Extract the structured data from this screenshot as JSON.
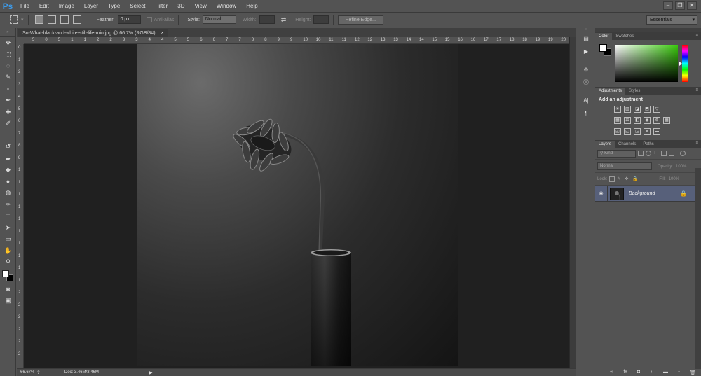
{
  "app": {
    "logo": "Ps"
  },
  "menu": [
    "File",
    "Edit",
    "Image",
    "Layer",
    "Type",
    "Select",
    "Filter",
    "3D",
    "View",
    "Window",
    "Help"
  ],
  "window_controls": {
    "minimize": "–",
    "restore": "❐",
    "close": "✕"
  },
  "options": {
    "feather_label": "Feather:",
    "feather_value": "0 px",
    "antialias_label": "Anti-alias",
    "style_label": "Style:",
    "style_value": "Normal",
    "width_label": "Width:",
    "height_label": "Height:",
    "refine_edge": "Refine Edge...",
    "swap_icon": "⇄"
  },
  "workspace": "Essentials",
  "document": {
    "tab_title": "So-What-black-and-white-still-life-min.jpg @ 66.7% (RGB/8#)",
    "tab_close": "×",
    "zoom": "66.67%",
    "doc_size": "Doc: 3.46M/3.46M",
    "status_arrow": "▶",
    "ruler_top": [
      "5",
      "0",
      "5",
      "1",
      "1",
      "2",
      "2",
      "3",
      "3",
      "4",
      "4",
      "5",
      "5",
      "6",
      "6",
      "7",
      "7",
      "8",
      "8",
      "9",
      "9",
      "10",
      "10",
      "11",
      "11",
      "12",
      "12",
      "13",
      "13",
      "14",
      "14",
      "15",
      "15",
      "16",
      "16",
      "17",
      "17",
      "18",
      "18",
      "19",
      "19",
      "20"
    ],
    "ruler_left": [
      "0",
      "1",
      "2",
      "3",
      "4",
      "5",
      "6",
      "7",
      "8",
      "9",
      "1",
      "1",
      "1",
      "1",
      "1",
      "1",
      "1",
      "1",
      "1",
      "1",
      "2",
      "2",
      "2",
      "2",
      "2",
      "2"
    ]
  },
  "tools": [
    {
      "name": "move-tool",
      "glyph": "✥"
    },
    {
      "name": "marquee-tool",
      "glyph": "⬚"
    },
    {
      "name": "lasso-tool",
      "glyph": "◌"
    },
    {
      "name": "quick-selection-tool",
      "glyph": "✎"
    },
    {
      "name": "crop-tool",
      "glyph": "⌗"
    },
    {
      "name": "eyedropper-tool",
      "glyph": "✒"
    },
    {
      "name": "healing-brush-tool",
      "glyph": "✚"
    },
    {
      "name": "brush-tool",
      "glyph": "✐"
    },
    {
      "name": "clone-stamp-tool",
      "glyph": "⊥"
    },
    {
      "name": "history-brush-tool",
      "glyph": "↺"
    },
    {
      "name": "eraser-tool",
      "glyph": "▰"
    },
    {
      "name": "paint-bucket-tool",
      "glyph": "◆"
    },
    {
      "name": "blur-tool",
      "glyph": "●"
    },
    {
      "name": "dodge-tool",
      "glyph": "◍"
    },
    {
      "name": "pen-tool",
      "glyph": "✑"
    },
    {
      "name": "type-tool",
      "glyph": "T"
    },
    {
      "name": "path-selection-tool",
      "glyph": "➤"
    },
    {
      "name": "rectangle-tool",
      "glyph": "▭"
    },
    {
      "name": "hand-tool",
      "glyph": "✋"
    },
    {
      "name": "zoom-tool",
      "glyph": "⚲"
    }
  ],
  "tools_bottom": [
    {
      "name": "quick-mask-icon",
      "glyph": "◙"
    },
    {
      "name": "screen-mode-icon",
      "glyph": "▣"
    }
  ],
  "dock": [
    {
      "name": "history-panel-icon",
      "glyph": "▤"
    },
    {
      "name": "actions-panel-icon",
      "glyph": "▶"
    },
    {
      "name": "properties-panel-icon",
      "glyph": "⚙"
    },
    {
      "name": "info-panel-icon",
      "glyph": "ⓘ"
    },
    {
      "name": "character-panel-icon",
      "glyph": "A|"
    },
    {
      "name": "paragraph-panel-icon",
      "glyph": "¶"
    }
  ],
  "color_panel": {
    "tabs": [
      "Color",
      "Swatches"
    ],
    "menu": "≡"
  },
  "adjustments_panel": {
    "tabs": [
      "Adjustments",
      "Styles"
    ],
    "menu": "≡",
    "title": "Add an adjustment",
    "rows": [
      [
        {
          "name": "brightness-contrast-icon",
          "glyph": "☀"
        },
        {
          "name": "levels-icon",
          "glyph": "▥"
        },
        {
          "name": "curves-icon",
          "glyph": "◪"
        },
        {
          "name": "exposure-icon",
          "glyph": "◩"
        },
        {
          "name": "vibrance-icon",
          "glyph": "▽"
        }
      ],
      [
        {
          "name": "hue-saturation-icon",
          "glyph": "▦"
        },
        {
          "name": "color-balance-icon",
          "glyph": "⚖"
        },
        {
          "name": "black-white-icon",
          "glyph": "◧"
        },
        {
          "name": "photo-filter-icon",
          "glyph": "◉"
        },
        {
          "name": "channel-mixer-icon",
          "glyph": "⊛"
        },
        {
          "name": "color-lookup-icon",
          "glyph": "▦"
        }
      ],
      [
        {
          "name": "invert-icon",
          "glyph": "◰"
        },
        {
          "name": "posterize-icon",
          "glyph": "◱"
        },
        {
          "name": "threshold-icon",
          "glyph": "◲"
        },
        {
          "name": "selective-color-icon",
          "glyph": "✕"
        },
        {
          "name": "gradient-map-icon",
          "glyph": "▬"
        }
      ]
    ]
  },
  "layers_panel": {
    "tabs": [
      "Layers",
      "Channels",
      "Paths"
    ],
    "menu": "≡",
    "filter_label": "Kind",
    "blend_mode": "Normal",
    "opacity_label": "Opacity:",
    "opacity_value": "100%",
    "lock_label": "Lock:",
    "fill_label": "Fill:",
    "fill_value": "100%",
    "layer": {
      "name": "Background",
      "eye": "👁",
      "lock": "🔒"
    },
    "footer": [
      {
        "name": "link-layers-icon",
        "glyph": "∞"
      },
      {
        "name": "layer-style-icon",
        "glyph": "fx"
      },
      {
        "name": "add-mask-icon",
        "glyph": "◘"
      },
      {
        "name": "new-adjustment-icon",
        "glyph": "◐"
      },
      {
        "name": "new-group-icon",
        "glyph": "▬"
      },
      {
        "name": "new-layer-icon",
        "glyph": "▫"
      },
      {
        "name": "delete-layer-icon",
        "glyph": "🗑"
      }
    ]
  }
}
